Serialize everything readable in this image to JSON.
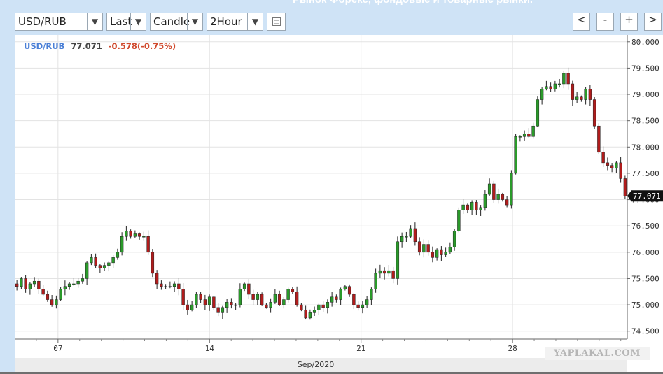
{
  "header": {
    "title": "Рынок Форекс, фондовые и товарные рынки."
  },
  "toolbar": {
    "symbol": "USD/RUB",
    "price_type": "Last",
    "chart_style": "Candle",
    "interval": "2Hour",
    "dropdown_glyph": "▼",
    "calendar_icon": "calendar-icon",
    "nav": {
      "prev": "<",
      "zoom_out": "-",
      "zoom_in": "+",
      "next": ">"
    }
  },
  "quote": {
    "symbol": "USD/RUB",
    "last": "77.071",
    "change": "-0.578(-0.75%)"
  },
  "watermark": "YAPLAKAL.COM",
  "colors": {
    "up": "#2a9a2a",
    "down": "#b01c1c",
    "symbol": "#4a7fd6",
    "change": "#d04a2e"
  },
  "chart_data": {
    "type": "candlestick",
    "symbol": "USD/RUB",
    "interval": "2Hour",
    "xlabel": "Sep/2020",
    "x_ticks": [
      "07",
      "14",
      "21",
      "28"
    ],
    "x_tick_days": [
      7,
      14,
      21,
      28
    ],
    "x_range_days": [
      5,
      33.3
    ],
    "ylim": [
      74.35,
      80.13
    ],
    "y_ticks": [
      74.5,
      75.0,
      75.5,
      76.0,
      76.5,
      77.0,
      77.5,
      78.0,
      78.5,
      79.0,
      79.5,
      80.0
    ],
    "last_price": 77.071,
    "grid": true,
    "approx_closes": [
      75.35,
      75.5,
      75.3,
      75.4,
      75.45,
      75.3,
      75.2,
      75.1,
      75.0,
      75.1,
      75.3,
      75.35,
      75.4,
      75.4,
      75.45,
      75.5,
      75.8,
      75.9,
      75.75,
      75.7,
      75.75,
      75.8,
      75.9,
      76.0,
      76.3,
      76.4,
      76.3,
      76.35,
      76.3,
      76.3,
      76.0,
      75.6,
      75.4,
      75.35,
      75.35,
      75.35,
      75.4,
      75.3,
      75.0,
      74.9,
      75.0,
      75.2,
      75.1,
      75.0,
      75.15,
      74.95,
      74.85,
      74.95,
      75.05,
      75.0,
      75.0,
      75.3,
      75.4,
      75.2,
      75.1,
      75.2,
      75.0,
      74.95,
      75.05,
      75.2,
      75.0,
      75.1,
      75.3,
      75.25,
      75.0,
      74.9,
      74.75,
      74.85,
      74.9,
      75.0,
      74.95,
      75.05,
      75.15,
      75.1,
      75.3,
      75.35,
      75.2,
      75.0,
      74.95,
      75.0,
      75.1,
      75.3,
      75.6,
      75.65,
      75.6,
      75.65,
      75.5,
      76.2,
      76.3,
      76.3,
      76.45,
      76.2,
      76.0,
      76.15,
      76.0,
      75.9,
      76.05,
      75.95,
      76.0,
      76.1,
      76.4,
      76.8,
      76.9,
      76.8,
      76.95,
      76.8,
      76.85,
      77.1,
      77.3,
      77.0,
      77.1,
      77.0,
      76.9,
      77.5,
      78.2,
      78.2,
      78.25,
      78.2,
      78.4,
      78.9,
      79.1,
      79.15,
      79.1,
      79.2,
      79.2,
      79.4,
      79.2,
      78.9,
      78.95,
      78.9,
      79.1,
      78.9,
      78.4,
      77.9,
      77.7,
      77.65,
      77.6,
      77.7,
      77.4,
      77.071
    ]
  }
}
